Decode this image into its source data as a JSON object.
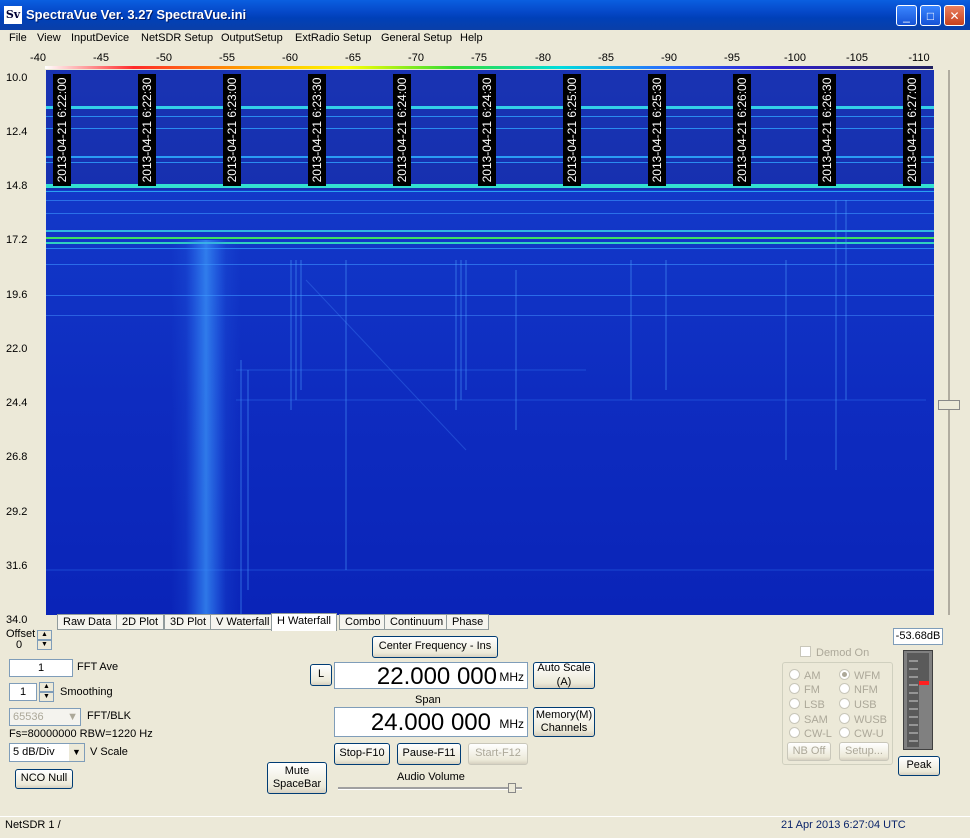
{
  "window": {
    "title": "SpectraVue Ver. 3.27  SpectraVue.ini",
    "icon_label": "Sv",
    "minimize": "_",
    "maximize": "□",
    "close": "✕"
  },
  "menu": [
    "File",
    "View",
    "InputDevice",
    "NetSDR Setup",
    "OutputSetup",
    "ExtRadio Setup",
    "General Setup",
    "Help"
  ],
  "db_scale": [
    "-40",
    "-45",
    "-50",
    "-55",
    "-60",
    "-65",
    "-70",
    "-75",
    "-80",
    "-85",
    "-90",
    "-95",
    "-100",
    "-105",
    "-110"
  ],
  "y_axis": [
    "10.0",
    "12.4",
    "14.8",
    "17.2",
    "19.6",
    "22.0",
    "24.4",
    "26.8",
    "29.2",
    "31.6",
    "34.0"
  ],
  "timestamps": [
    "2013-04-21 6:22:00",
    "2013-04-21 6:22:30",
    "2013-04-21 6:23:00",
    "2013-04-21 6:23:30",
    "2013-04-21 6:24:00",
    "2013-04-21 6:24:30",
    "2013-04-21 6:25:00",
    "2013-04-21 6:25:30",
    "2013-04-21 6:26:00",
    "2013-04-21 6:26:30",
    "2013-04-21 6:27:00"
  ],
  "tabs": [
    "Raw Data",
    "2D Plot",
    "3D Plot",
    "V Waterfall",
    "H Waterfall",
    "Combo",
    "Continuum",
    "Phase"
  ],
  "active_tab": "H Waterfall",
  "controls": {
    "offset_label": "Offset",
    "offset_value": "0",
    "fft_ave_value": "1",
    "fft_ave_label": "FFT Ave",
    "smoothing_value": "1",
    "smoothing_label": "Smoothing",
    "fft_blk_value": "65536",
    "fft_blk_label": "FFT/BLK",
    "fs_info": "Fs=80000000 RBW=1220 Hz",
    "vscale_value": "5 dB/Div",
    "vscale_label": "V Scale",
    "nco_null": "NCO Null",
    "mute": "Mute\nSpaceBar",
    "center_freq_btn": "Center Frequency - Ins",
    "l_btn": "L",
    "center_freq": "22.000 000",
    "center_unit": "MHz",
    "auto_scale": "Auto Scale\n(A)",
    "span_label": "Span",
    "span": "24.000 000",
    "span_unit": "MHz",
    "memory": "Memory(M)\nChannels",
    "stop": "Stop-F10",
    "pause": "Pause-F11",
    "start": "Start-F12",
    "audio_volume": "Audio Volume"
  },
  "demod": {
    "checkbox": "Demod On",
    "left": [
      "AM",
      "FM",
      "LSB",
      "SAM",
      "CW-L"
    ],
    "right": [
      "WFM",
      "NFM",
      "USB",
      "WUSB",
      "CW-U"
    ],
    "selected": "WFM",
    "nb_off": "NB Off",
    "setup": "Setup..."
  },
  "meter": {
    "level": "-53.68dB",
    "peak": "Peak"
  },
  "status": {
    "left": "NetSDR 1  /",
    "right": "21 Apr 2013  6:27:04 UTC"
  },
  "colors": {
    "titlebar": "#0548c8",
    "waterfall_bg": "#0f30c0",
    "status_right": "#0a246a"
  }
}
